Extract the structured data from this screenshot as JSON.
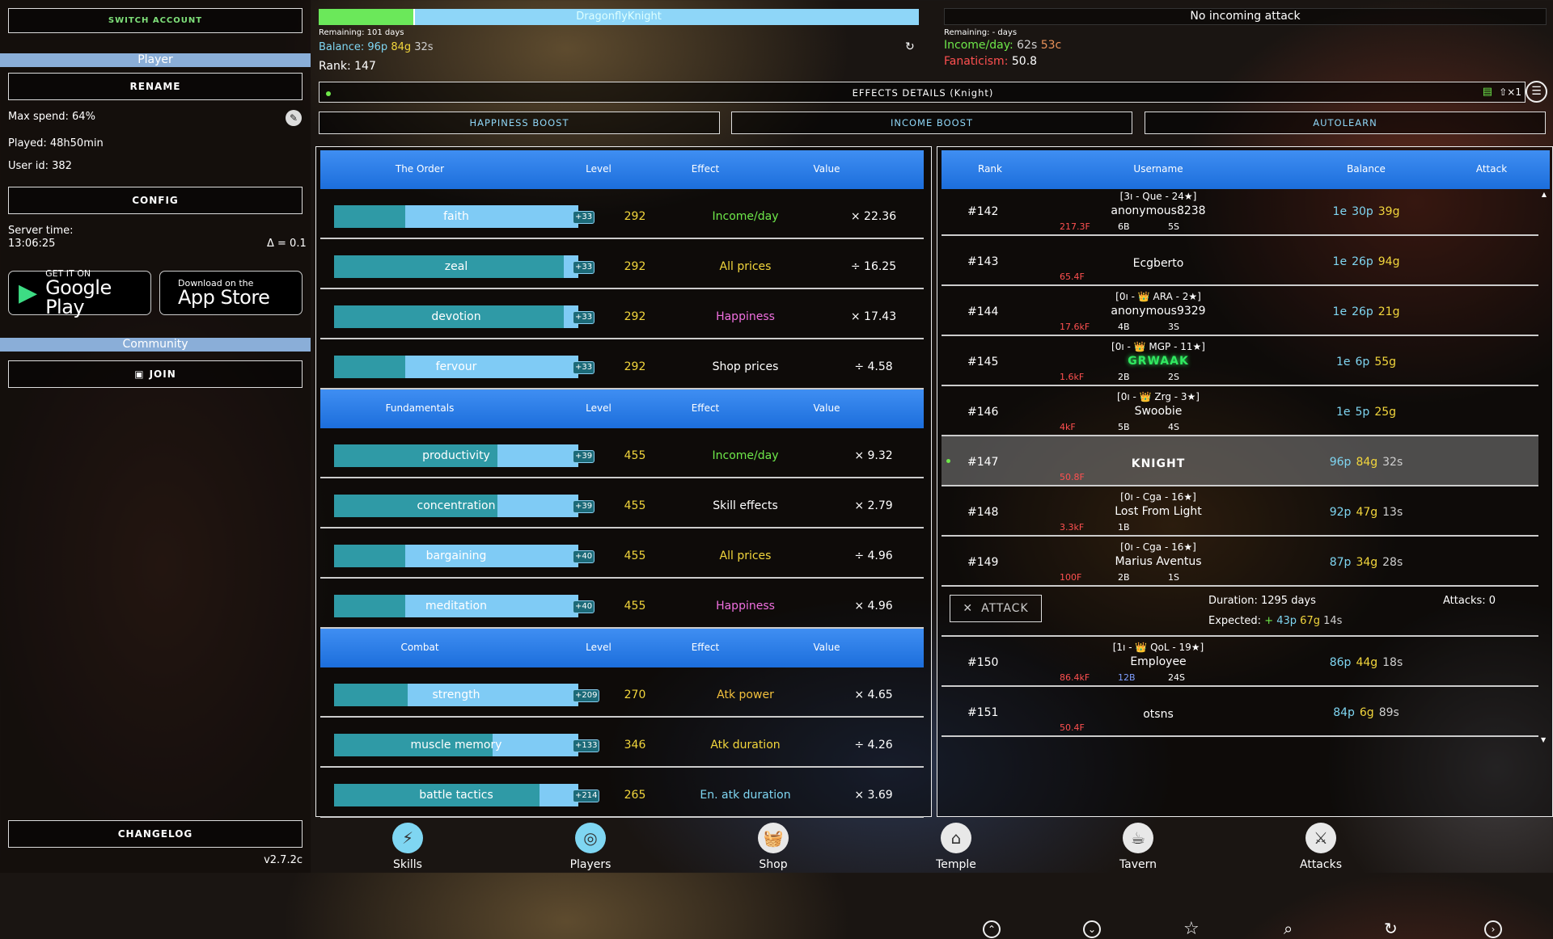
{
  "sidebar": {
    "switch_account": "SWITCH ACCOUNT",
    "player_header": "Player",
    "rename": "RENAME",
    "max_spend": "Max spend: 64%",
    "played": "Played: 48h50min",
    "user_id": "User id: 382",
    "config": "CONFIG",
    "server_time_label": "Server time:",
    "server_time": "13:06:25",
    "delta": "Δ = 0.1",
    "google_top": "GET IT ON",
    "google_bottom": "Google Play",
    "apple_top": "Download on the",
    "apple_bottom": "App Store",
    "community_header": "Community",
    "join": "JOIN",
    "changelog": "CHANGELOG",
    "version": "v2.7.2c"
  },
  "header": {
    "player_name": "DragonflyKnight",
    "player_bar_fill": 0.16,
    "remaining": "Remaining: 101 days",
    "balance_label": "Balance:",
    "balance_p": "96p",
    "balance_g": "84g",
    "balance_s": "32s",
    "rank": "Rank: 147",
    "attack_status": "No incoming attack",
    "attack_remaining": "Remaining: - days",
    "income_label": "Income/day:",
    "income_g": "62s",
    "income_s": "53c",
    "fanaticism_label": "Fanaticism:",
    "fanaticism_value": "50.8",
    "effects_details": "EFFECTS DETAILS (Knight)",
    "effects_multiplier": "⇧×1",
    "happiness_boost": "HAPPINESS BOOST",
    "income_boost": "INCOME BOOST",
    "autolearn": "AUTOLEARN"
  },
  "skills": {
    "col_level": "Level",
    "col_effect": "Effect",
    "col_value": "Value",
    "sections": [
      {
        "title": "The Order",
        "rows": [
          {
            "name": "faith",
            "bonus": "+33",
            "level": "292",
            "effect": "Income/day",
            "effect_color": "#6ee84a",
            "value": "× 22.36",
            "fill": 0.29
          },
          {
            "name": "zeal",
            "bonus": "+33",
            "level": "292",
            "effect": "All prices",
            "effect_color": "#f2d63c",
            "value": "÷ 16.25",
            "fill": 0.94
          },
          {
            "name": "devotion",
            "bonus": "+33",
            "level": "292",
            "effect": "Happiness",
            "effect_color": "#f070e0",
            "value": "× 17.43",
            "fill": 0.94
          },
          {
            "name": "fervour",
            "bonus": "+33",
            "level": "292",
            "effect": "Shop prices",
            "effect_color": "#ffffff",
            "value": "÷ 4.58",
            "fill": 0.29
          }
        ]
      },
      {
        "title": "Fundamentals",
        "rows": [
          {
            "name": "productivity",
            "bonus": "+39",
            "level": "455",
            "effect": "Income/day",
            "effect_color": "#6ee84a",
            "value": "× 9.32",
            "fill": 0.67
          },
          {
            "name": "concentration",
            "bonus": "+39",
            "level": "455",
            "effect": "Skill effects",
            "effect_color": "#ffffff",
            "value": "× 2.79",
            "fill": 0.67
          },
          {
            "name": "bargaining",
            "bonus": "+40",
            "level": "455",
            "effect": "All prices",
            "effect_color": "#f2d63c",
            "value": "÷ 4.96",
            "fill": 0.29
          },
          {
            "name": "meditation",
            "bonus": "+40",
            "level": "455",
            "effect": "Happiness",
            "effect_color": "#f070e0",
            "value": "× 4.96",
            "fill": 0.29
          }
        ]
      },
      {
        "title": "Combat",
        "rows": [
          {
            "name": "strength",
            "bonus": "+209",
            "level": "270",
            "effect": "Atk power",
            "effect_color": "#f2c03c",
            "value": "× 4.65",
            "fill": 0.3
          },
          {
            "name": "muscle memory",
            "bonus": "+133",
            "level": "346",
            "effect": "Atk duration",
            "effect_color": "#f2d63c",
            "value": "÷ 4.26",
            "fill": 0.65
          },
          {
            "name": "battle tactics",
            "bonus": "+214",
            "level": "265",
            "effect": "En. atk duration",
            "effect_color": "#7fd6f2",
            "value": "× 3.69",
            "fill": 0.84
          }
        ]
      }
    ]
  },
  "leaderboard": {
    "col_rank": "Rank",
    "col_username": "Username",
    "col_balance": "Balance",
    "col_attack": "Attack",
    "rows": [
      {
        "rank": "#142",
        "tag": "[3ı - Que - 24★]",
        "name": "anonymous8238",
        "fan": "217.3F",
        "b": "6B",
        "s": "5S",
        "bal": [
          "1e",
          "30p",
          "39g"
        ],
        "highlight": false,
        "glow": false
      },
      {
        "rank": "#143",
        "tag": "",
        "name": "Ecgberto",
        "fan": "65.4F",
        "b": "",
        "s": "",
        "bal": [
          "1e",
          "26p",
          "94g"
        ],
        "highlight": false,
        "glow": false
      },
      {
        "rank": "#144",
        "tag": "[0ı - 👑 ARA - 2★]",
        "name": "anonymous9329",
        "fan": "17.6kF",
        "b": "4B",
        "s": "3S",
        "bal": [
          "1e",
          "26p",
          "21g"
        ],
        "highlight": false,
        "glow": false
      },
      {
        "rank": "#145",
        "tag": "[0ı - 👑 MGP - 11★]",
        "name": "GRWAAK",
        "fan": "1.6kF",
        "b": "2B",
        "s": "2S",
        "bal": [
          "1e",
          "6p",
          "55g"
        ],
        "highlight": false,
        "glow": true
      },
      {
        "rank": "#146",
        "tag": "[0ı - 👑 Zrg - 3★]",
        "name": "Swoobie",
        "fan": "4kF",
        "b": "5B",
        "s": "4S",
        "bal": [
          "1e",
          "5p",
          "25g"
        ],
        "highlight": false,
        "glow": false
      },
      {
        "rank": "#147",
        "tag": "",
        "name": "KNIGHT",
        "fan": "50.8F",
        "b": "",
        "s": "",
        "bal": [
          "",
          "96p",
          "84g",
          "32s"
        ],
        "highlight": true,
        "glow": false
      },
      {
        "rank": "#148",
        "tag": "[0ı - Cga - 16★]",
        "name": "Lost From Light",
        "fan": "3.3kF",
        "b": "1B",
        "s": "",
        "bal": [
          "",
          "92p",
          "47g",
          "13s"
        ],
        "highlight": false,
        "glow": false
      },
      {
        "rank": "#149",
        "tag": "[0ı - Cga - 16★]",
        "name": "Marius Aventus",
        "fan": "100F",
        "b": "2B",
        "s": "1S",
        "bal": [
          "",
          "87p",
          "34g",
          "28s"
        ],
        "highlight": false,
        "glow": false
      },
      {
        "rank": "#150",
        "tag": "[1ı - 👑 QoL - 19★]",
        "name": "Employee",
        "fan": "86.4kF",
        "b": "12B",
        "s": "24S",
        "bal": [
          "",
          "86p",
          "44g",
          "18s"
        ],
        "highlight": false,
        "glow": false
      },
      {
        "rank": "#151",
        "tag": "",
        "name": "otsns",
        "fan": "50.4F",
        "b": "",
        "s": "",
        "bal": [
          "",
          "84p",
          "6g",
          "89s"
        ],
        "highlight": false,
        "glow": false
      }
    ],
    "attack_label": "ATTACK",
    "duration": "Duration: 1295 days",
    "attacks": "Attacks: 0",
    "expected_label": "Expected:",
    "expected_plus": "+",
    "expected_p": "43p",
    "expected_g": "67g",
    "expected_s": "14s"
  },
  "nav": [
    {
      "label": "Skills",
      "icon": "⚡",
      "active": true
    },
    {
      "label": "Players",
      "icon": "◎",
      "active": true
    },
    {
      "label": "Shop",
      "icon": "🧺",
      "active": false
    },
    {
      "label": "Temple",
      "icon": "⌂",
      "active": false
    },
    {
      "label": "Tavern",
      "icon": "☕",
      "active": false
    },
    {
      "label": "Attacks",
      "icon": "⚔",
      "active": false
    }
  ],
  "colors": {
    "accent_blue": "#2a7de8",
    "gold": "#f2d63c",
    "platinum": "#7fd6f2",
    "green": "#6ee84a"
  }
}
